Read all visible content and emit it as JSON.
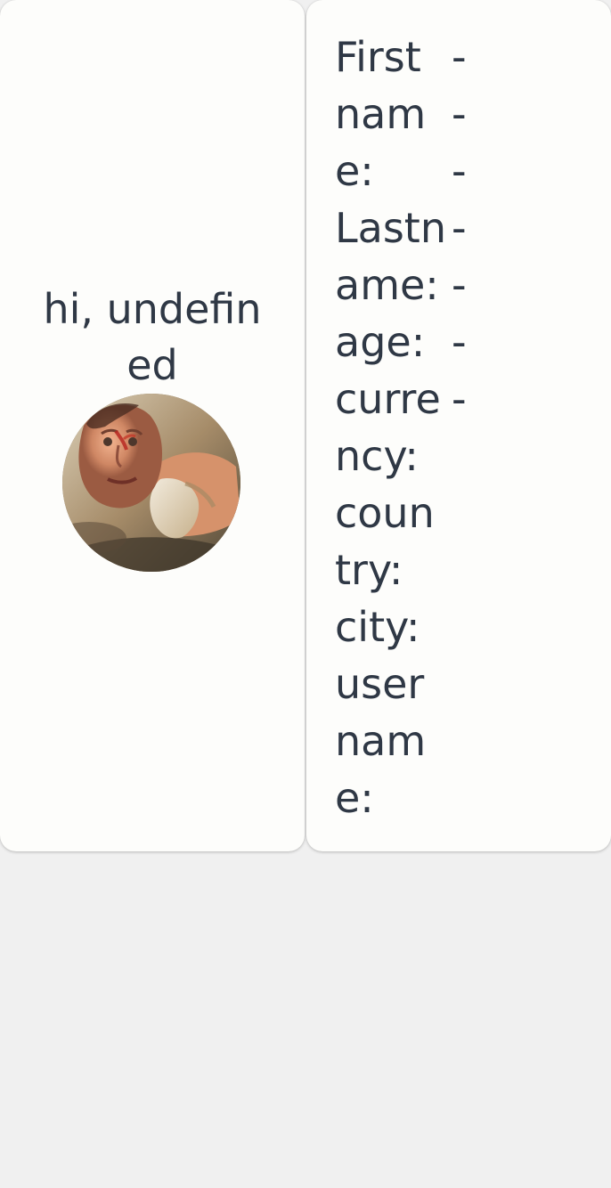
{
  "greeting": {
    "text": "hi, undefined"
  },
  "profile": {
    "fields": [
      {
        "label": "First name:",
        "value": "-"
      },
      {
        "label": "Lastname:",
        "value": "-"
      },
      {
        "label": "age:",
        "value": "-"
      },
      {
        "label": "currency:",
        "value": "-"
      },
      {
        "label": "country:",
        "value": "-"
      },
      {
        "label": "city:",
        "value": "-"
      },
      {
        "label": "username:",
        "value": "-"
      }
    ]
  },
  "colors": {
    "page_background": "#f0f0f0",
    "card_background": "#fdfdfb",
    "text": "#2f3845"
  },
  "icons": {
    "avatar": "avatar-photo"
  }
}
